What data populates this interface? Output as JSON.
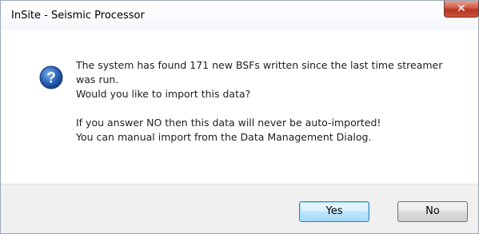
{
  "window": {
    "title": "InSite - Seismic Processor",
    "close_glyph": "✕"
  },
  "dialog": {
    "icon": "question-icon",
    "message_lines_1": [
      "The system has found 171 new BSFs written since the last time streamer",
      "was run.",
      "Would you like to import this data?"
    ],
    "message_lines_2": [
      "If you answer NO then this data will never be auto-imported!",
      "You can manual import from the Data Management Dialog."
    ]
  },
  "buttons": {
    "yes_label": "Yes",
    "no_label": "No"
  },
  "colors": {
    "icon_blue": "#2a63b8",
    "close_red": "#c9533b",
    "footer_bg": "#f0f0f0"
  }
}
